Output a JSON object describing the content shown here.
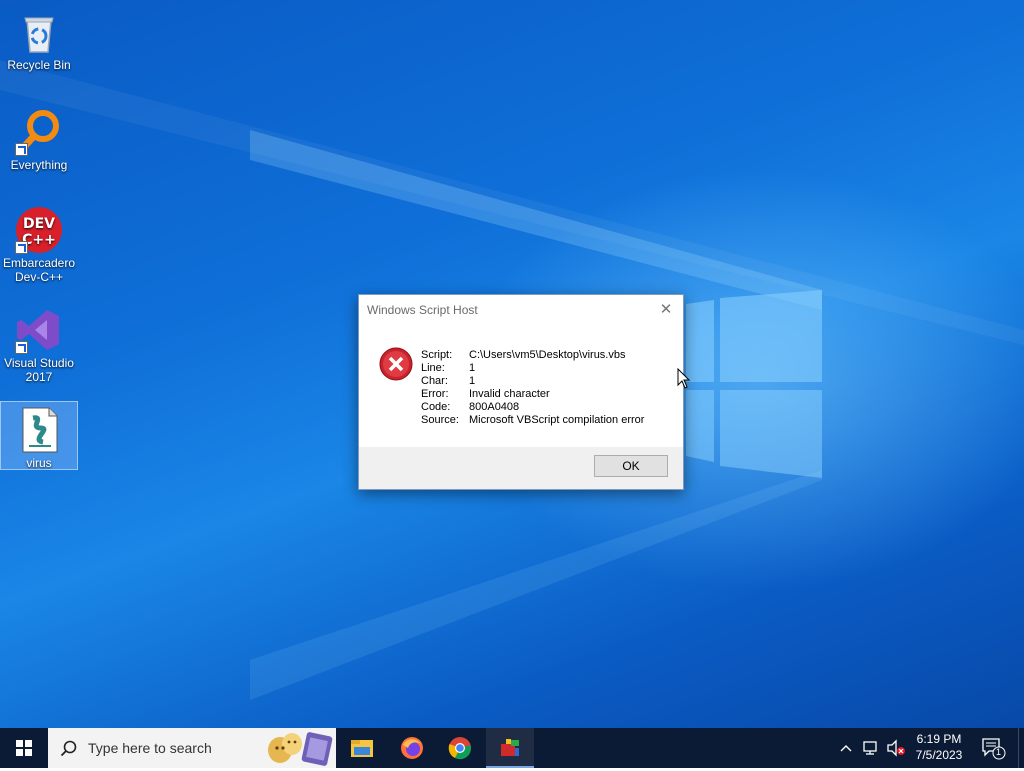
{
  "desktop": {
    "icons": [
      {
        "label": "Recycle Bin",
        "icon": "recycle-bin-icon"
      },
      {
        "label": "Everything",
        "icon": "everything-search-icon"
      },
      {
        "label": "Embarcadero Dev-C++",
        "icon": "dev-cpp-icon"
      },
      {
        "label": "Visual Studio 2017",
        "icon": "visual-studio-icon"
      },
      {
        "label": "virus",
        "icon": "vbs-script-file-icon"
      }
    ]
  },
  "dialog": {
    "title": "Windows Script Host",
    "close_icon": "close-icon",
    "error_icon": "error-icon",
    "fields": [
      {
        "label": "Script:",
        "value": "C:\\Users\\vm5\\Desktop\\virus.vbs"
      },
      {
        "label": "Line:",
        "value": "1"
      },
      {
        "label": "Char:",
        "value": "1"
      },
      {
        "label": "Error:",
        "value": "Invalid character"
      },
      {
        "label": "Code:",
        "value": "800A0408"
      },
      {
        "label": "Source:",
        "value": "Microsoft VBScript compilation error"
      }
    ],
    "ok_label": "OK"
  },
  "taskbar": {
    "search_placeholder": "Type here to search",
    "pinned": [
      "file-explorer-icon",
      "firefox-icon",
      "chrome-icon",
      "app-icon"
    ],
    "time": "6:19 PM",
    "date": "7/5/2023",
    "notification_count": "1"
  }
}
